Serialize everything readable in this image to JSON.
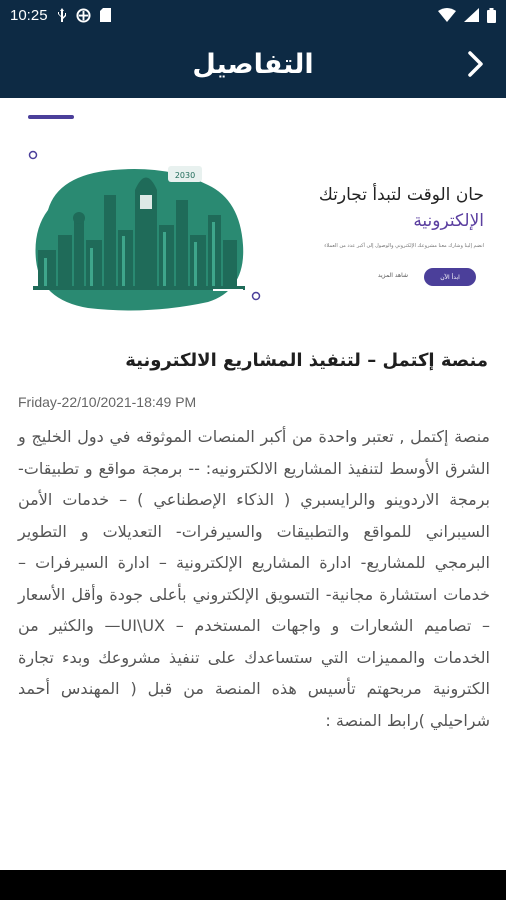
{
  "status_bar": {
    "time": "10:25"
  },
  "app_bar": {
    "title": "التفاصيل"
  },
  "banner": {
    "headline": "حان الوقت لتبدأ تجارتك",
    "headline_accent": "الإلكترونية",
    "subtext": "انضم إلينا وشارك معنا مشروعك الإلكتروني والوصول إلى أكبر عدد من العملاء",
    "cta_label": "ابدأ الآن",
    "link_label": "شاهد المزيد",
    "vision_badge": "2030"
  },
  "article": {
    "title": "منصة إكتمل – لتنفيذ المشاريع الالكترونية",
    "date": "Friday-22/10/2021-18:49 PM",
    "body": "منصة إكتمل , تعتبر واحدة من أكبر المنصات الموثوقه في دول الخليج و الشرق الأوسط لتنفيذ المشاريع الالكترونيه: -- برمجة مواقع و تطبيقات- برمجة الاردوينو والرايسبري ( الذكاء الإصطناعي ) – خدمات الأمن السيبراني للمواقع والتطبيقات والسيرفرات- التعديلات و التطوير البرمجي للمشاريع- ادارة المشاريع الإلكترونية – ادارة السيرفرات – خدمات استشارة مجانية- التسويق الإلكتروني بأعلى جودة وأقل الأسعار – تصاميم الشعارات و واجهات المستخدم – UI\\UX— والكثير من الخدمات والمميزات التي ستساعدك على تنفيذ مشروعك وبدء تجارة الكترونية مربحهتم تأسيس هذه المنصة من قبل ( المهندس أحمد شراحيلي )رابط المنصة :"
  },
  "colors": {
    "header_bg": "#0d2a44",
    "accent": "#4b3f9a",
    "skyline_green": "#2a8a72"
  }
}
